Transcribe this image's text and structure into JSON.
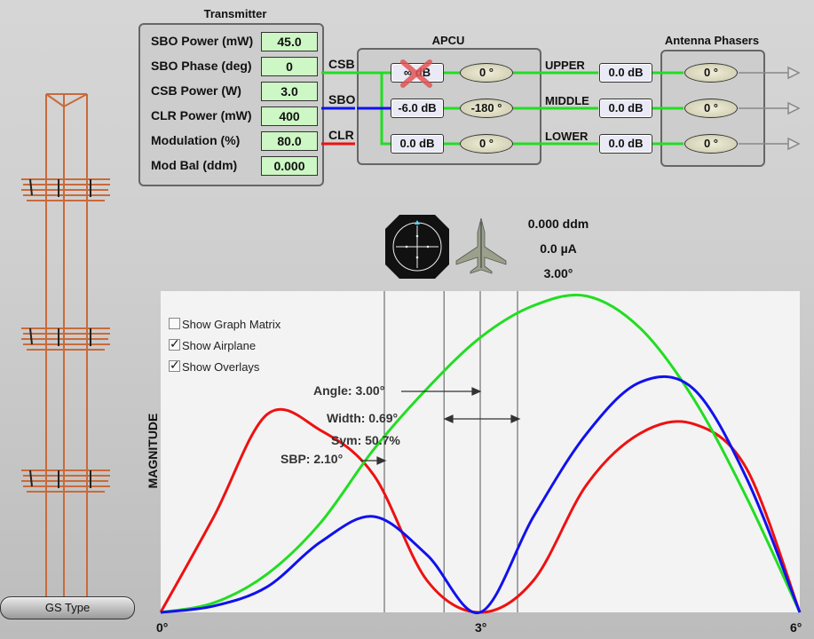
{
  "transmitter": {
    "title": "Transmitter",
    "rows": [
      {
        "label": "SBO Power (mW)",
        "value": "45.0"
      },
      {
        "label": "SBO Phase (deg)",
        "value": "0"
      },
      {
        "label": "CSB Power (W)",
        "value": "3.0"
      },
      {
        "label": "CLR Power (mW)",
        "value": "400"
      },
      {
        "label": "Modulation (%)",
        "value": "80.0"
      },
      {
        "label": "Mod Bal (ddm)",
        "value": "0.000"
      }
    ]
  },
  "lines": {
    "csb": "CSB",
    "sbo": "SBO",
    "clr": "CLR"
  },
  "colors": {
    "csb": "#22dd22",
    "sbo": "#1111ee",
    "clr": "#ee1111"
  },
  "apcu": {
    "title": "APCU",
    "rows": [
      {
        "db": "∞ dB",
        "phase": "0 °",
        "disabled": true
      },
      {
        "db": "-6.0 dB",
        "phase": "-180 °"
      },
      {
        "db": "0.0 dB",
        "phase": "0 °"
      }
    ]
  },
  "outputs": [
    {
      "label": "UPPER",
      "db": "0.0 dB"
    },
    {
      "label": "MIDDLE",
      "db": "0.0 dB"
    },
    {
      "label": "LOWER",
      "db": "0.0 dB"
    }
  ],
  "phasers": {
    "title": "Antenna Phasers",
    "values": [
      "0 °",
      "0 °",
      "0 °"
    ]
  },
  "readout": {
    "ddm": "0.000 ddm",
    "current": "0.0 µA",
    "angle": "3.00°"
  },
  "options": [
    {
      "label": "Show Graph Matrix",
      "checked": false
    },
    {
      "label": "Show Airplane",
      "checked": true
    },
    {
      "label": "Show Overlays",
      "checked": true
    }
  ],
  "annotations": {
    "angle": "Angle: 3.00°",
    "width": "Width: 0.69°",
    "sym": "Sym: 50.7%",
    "sbp": "SBP: 2.10°"
  },
  "gs_type_button": "GS Type",
  "chart_data": {
    "type": "line",
    "ylabel": "MAGNITUDE",
    "xlabel": "",
    "xlim": [
      0,
      6
    ],
    "ylim": [
      0,
      1.0
    ],
    "xticks": [
      "0°",
      "3°",
      "6°"
    ],
    "vlines": [
      2.1,
      2.66,
      3.0,
      3.35
    ],
    "series": [
      {
        "color": "#ee1111",
        "x": [
          0,
          0.5,
          1.0,
          1.5,
          2.0,
          2.5,
          3.0,
          3.5,
          4.0,
          4.5,
          5.0,
          5.5,
          6.0
        ],
        "y": [
          0,
          0.3,
          0.62,
          0.57,
          0.43,
          0.1,
          0,
          0.1,
          0.4,
          0.56,
          0.59,
          0.45,
          0
        ]
      },
      {
        "color": "#22dd22",
        "x": [
          0,
          0.5,
          1.0,
          1.5,
          2.0,
          2.5,
          3.0,
          3.5,
          4.0,
          4.5,
          5.0,
          5.5,
          6.0
        ],
        "y": [
          0,
          0.03,
          0.12,
          0.28,
          0.51,
          0.7,
          0.86,
          0.96,
          0.99,
          0.89,
          0.67,
          0.36,
          0
        ]
      },
      {
        "color": "#1111ee",
        "x": [
          0,
          0.5,
          1.0,
          1.5,
          2.0,
          2.5,
          3.0,
          3.5,
          4.0,
          4.5,
          5.0,
          5.5,
          6.0
        ],
        "y": [
          0,
          0.02,
          0.08,
          0.22,
          0.3,
          0.18,
          0,
          0.3,
          0.56,
          0.72,
          0.7,
          0.42,
          0
        ]
      }
    ]
  }
}
